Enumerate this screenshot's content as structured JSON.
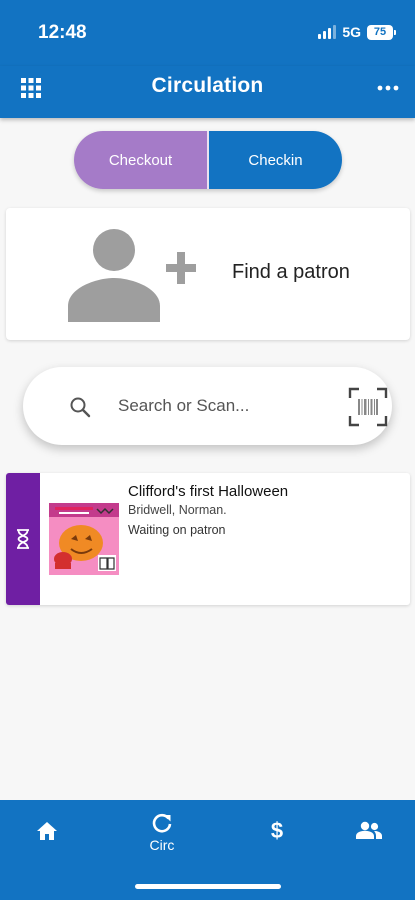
{
  "status_bar": {
    "time": "12:48",
    "network": "5G",
    "battery": "75"
  },
  "app_bar": {
    "title": "Circulation",
    "menu_icon": "grid-icon",
    "more_icon": "more-horizontal-icon"
  },
  "segments": {
    "checkout": "Checkout",
    "checkin": "Checkin",
    "selected": "checkout"
  },
  "patron": {
    "label": "Find a patron",
    "icon": "add-person-icon"
  },
  "search": {
    "placeholder": "Search or Scan...",
    "value": ""
  },
  "items": [
    {
      "title": "Clifford's first Halloween",
      "author": "Bridwell, Norman.",
      "status": "Waiting on patron",
      "status_icon": "hourglass-icon",
      "status_color": "#6f1fa3"
    }
  ],
  "bottom_nav": [
    {
      "icon": "home-icon",
      "label": ""
    },
    {
      "icon": "refresh-icon",
      "label": "Circ"
    },
    {
      "icon": "dollar-icon",
      "label": ""
    },
    {
      "icon": "people-icon",
      "label": ""
    }
  ],
  "colors": {
    "primary": "#1273c2",
    "checkout_accent": "#a57bc8",
    "status_waiting": "#6f1fa3",
    "background": "#f7f7f7"
  }
}
